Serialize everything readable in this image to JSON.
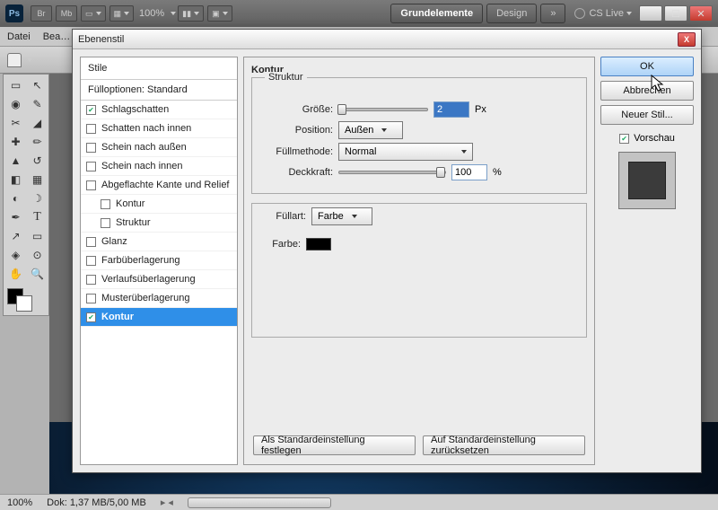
{
  "topbar": {
    "zoom": "100%",
    "workspaces": [
      "Grundelemente",
      "Design"
    ],
    "cslive": "CS Live"
  },
  "menubar": [
    "Datei",
    "Bea…"
  ],
  "dialog": {
    "title": "Ebenenstil",
    "styles_header": "Stile",
    "fill_opts": "Fülloptionen: Standard",
    "items": [
      {
        "label": "Schlagschatten",
        "checked": true
      },
      {
        "label": "Schatten nach innen",
        "checked": false
      },
      {
        "label": "Schein nach außen",
        "checked": false
      },
      {
        "label": "Schein nach innen",
        "checked": false
      },
      {
        "label": "Abgeflachte Kante und Relief",
        "checked": false
      },
      {
        "label": "Kontur",
        "checked": false,
        "sub": true
      },
      {
        "label": "Struktur",
        "checked": false,
        "sub": true
      },
      {
        "label": "Glanz",
        "checked": false
      },
      {
        "label": "Farbüberlagerung",
        "checked": false
      },
      {
        "label": "Verlaufsüberlagerung",
        "checked": false
      },
      {
        "label": "Musterüberlagerung",
        "checked": false
      },
      {
        "label": "Kontur",
        "checked": true,
        "selected": true
      }
    ],
    "panel": {
      "heading": "Kontur",
      "struct": "Struktur",
      "size_lbl": "Größe:",
      "size_val": "2",
      "size_unit": "Px",
      "pos_lbl": "Position:",
      "pos_val": "Außen",
      "blend_lbl": "Füllmethode:",
      "blend_val": "Normal",
      "opac_lbl": "Deckkraft:",
      "opac_val": "100",
      "opac_unit": "%",
      "filltype_lbl": "Füllart:",
      "filltype_val": "Farbe",
      "color_lbl": "Farbe:"
    },
    "defaults": {
      "make": "Als Standardeinstellung festlegen",
      "reset": "Auf Standardeinstellung zurücksetzen"
    },
    "buttons": {
      "ok": "OK",
      "cancel": "Abbrechen",
      "new": "Neuer Stil...",
      "preview": "Vorschau"
    }
  },
  "status": {
    "zoom": "100%",
    "doc": "Dok: 1,37 MB/5,00 MB"
  }
}
